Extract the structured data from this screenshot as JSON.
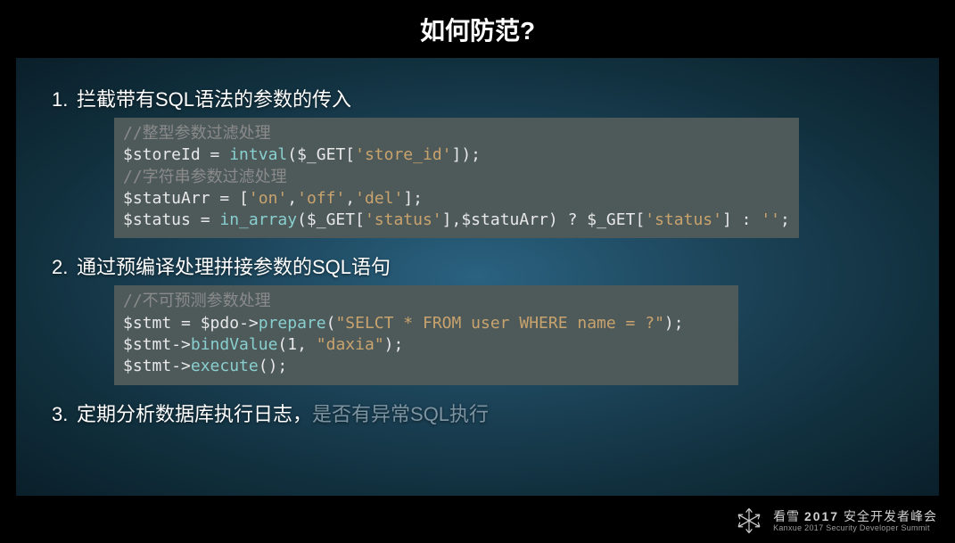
{
  "title": "如何防范?",
  "items": [
    {
      "num": "1.",
      "text": "拦截带有SQL语法的参数的传入",
      "code": {
        "tokens": [
          {
            "t": "comment",
            "v": "//整型参数过滤处理"
          },
          {
            "t": "nl"
          },
          {
            "t": "var",
            "v": "$storeId"
          },
          {
            "t": "op",
            "v": " = "
          },
          {
            "t": "func",
            "v": "intval"
          },
          {
            "t": "punct",
            "v": "("
          },
          {
            "t": "var",
            "v": "$_GET"
          },
          {
            "t": "punct",
            "v": "["
          },
          {
            "t": "str",
            "v": "'store_id'"
          },
          {
            "t": "punct",
            "v": "]);"
          },
          {
            "t": "nl"
          },
          {
            "t": "comment",
            "v": "//字符串参数过滤处理"
          },
          {
            "t": "nl"
          },
          {
            "t": "var",
            "v": "$statuArr"
          },
          {
            "t": "op",
            "v": " = "
          },
          {
            "t": "punct",
            "v": "["
          },
          {
            "t": "str",
            "v": "'on'"
          },
          {
            "t": "punct",
            "v": ","
          },
          {
            "t": "str",
            "v": "'off'"
          },
          {
            "t": "punct",
            "v": ","
          },
          {
            "t": "str",
            "v": "'del'"
          },
          {
            "t": "punct",
            "v": "];"
          },
          {
            "t": "nl"
          },
          {
            "t": "var",
            "v": "$status"
          },
          {
            "t": "op",
            "v": " = "
          },
          {
            "t": "func",
            "v": "in_array"
          },
          {
            "t": "punct",
            "v": "("
          },
          {
            "t": "var",
            "v": "$_GET"
          },
          {
            "t": "punct",
            "v": "["
          },
          {
            "t": "str",
            "v": "'status'"
          },
          {
            "t": "punct",
            "v": "],"
          },
          {
            "t": "var",
            "v": "$statuArr"
          },
          {
            "t": "punct",
            "v": ") ? "
          },
          {
            "t": "var",
            "v": "$_GET"
          },
          {
            "t": "punct",
            "v": "["
          },
          {
            "t": "str",
            "v": "'status'"
          },
          {
            "t": "punct",
            "v": "] : "
          },
          {
            "t": "str",
            "v": "''"
          },
          {
            "t": "punct",
            "v": ";"
          }
        ]
      }
    },
    {
      "num": "2.",
      "text": "通过预编译处理拼接参数的SQL语句",
      "code": {
        "tokens": [
          {
            "t": "comment",
            "v": "//不可预测参数处理"
          },
          {
            "t": "nl"
          },
          {
            "t": "var",
            "v": "$stmt"
          },
          {
            "t": "op",
            "v": " = "
          },
          {
            "t": "var",
            "v": "$pdo"
          },
          {
            "t": "op",
            "v": "->"
          },
          {
            "t": "func",
            "v": "prepare"
          },
          {
            "t": "punct",
            "v": "("
          },
          {
            "t": "str",
            "v": "\"SELCT * FROM user WHERE name = ?\""
          },
          {
            "t": "punct",
            "v": ");"
          },
          {
            "t": "nl"
          },
          {
            "t": "var",
            "v": "$stmt"
          },
          {
            "t": "op",
            "v": "->"
          },
          {
            "t": "func",
            "v": "bindValue"
          },
          {
            "t": "punct",
            "v": "("
          },
          {
            "t": "plain",
            "v": "1"
          },
          {
            "t": "punct",
            "v": ", "
          },
          {
            "t": "str",
            "v": "\"daxia\""
          },
          {
            "t": "punct",
            "v": ");"
          },
          {
            "t": "nl"
          },
          {
            "t": "var",
            "v": "$stmt"
          },
          {
            "t": "op",
            "v": "->"
          },
          {
            "t": "func",
            "v": "execute"
          },
          {
            "t": "punct",
            "v": "();"
          }
        ]
      }
    },
    {
      "num": "3.",
      "text": "定期分析数据库执行日志，",
      "tail": "是否有异常SQL执行"
    }
  ],
  "footer": {
    "brand": "看雪",
    "year": "2017",
    "cn": "安全开发者峰会",
    "en": "Kanxue 2017 Security Developer Summit"
  }
}
